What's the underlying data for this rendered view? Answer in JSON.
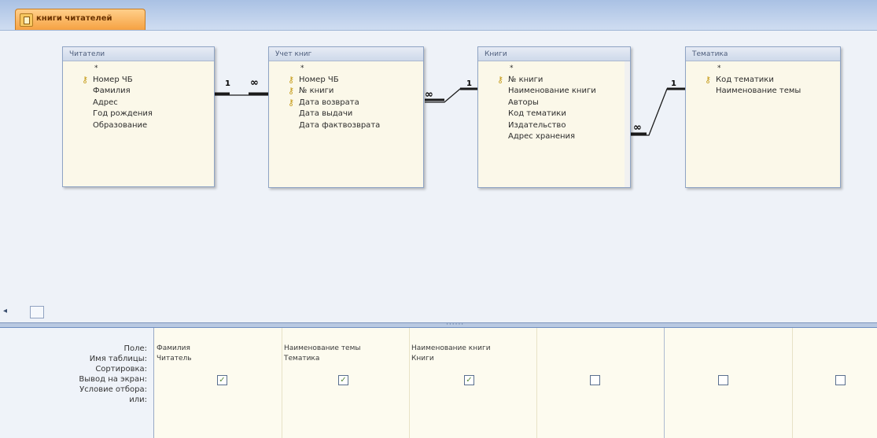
{
  "tab": {
    "title": "книги читателей",
    "icon": "query-icon"
  },
  "tables": [
    {
      "title": "Читатели",
      "fields": [
        {
          "name": "*",
          "key": false
        },
        {
          "name": "Номер ЧБ",
          "key": true
        },
        {
          "name": "Фамилия",
          "key": false
        },
        {
          "name": "Адрес",
          "key": false
        },
        {
          "name": "Год рождения",
          "key": false
        },
        {
          "name": "Образование",
          "key": false
        }
      ]
    },
    {
      "title": "Учет книг",
      "fields": [
        {
          "name": "*",
          "key": false
        },
        {
          "name": "Номер ЧБ",
          "key": true
        },
        {
          "name": "№ книги",
          "key": true
        },
        {
          "name": "Дата возврата",
          "key": true
        },
        {
          "name": "Дата выдачи",
          "key": false
        },
        {
          "name": "Дата фактвозврата",
          "key": false
        }
      ]
    },
    {
      "title": "Книги",
      "fields": [
        {
          "name": "*",
          "key": false
        },
        {
          "name": "№ книги",
          "key": true
        },
        {
          "name": "Наименование книги",
          "key": false
        },
        {
          "name": "Авторы",
          "key": false
        },
        {
          "name": "Код тематики",
          "key": false
        },
        {
          "name": "Издательство",
          "key": false
        },
        {
          "name": "Адрес хранения",
          "key": false
        }
      ]
    },
    {
      "title": "Тематика",
      "fields": [
        {
          "name": "*",
          "key": false
        },
        {
          "name": "Код тематики",
          "key": true
        },
        {
          "name": "Наименование темы",
          "key": false
        }
      ]
    }
  ],
  "relations": [
    {
      "one_label": "1",
      "many_label": "∞"
    },
    {
      "one_label": "1",
      "many_label": "∞"
    },
    {
      "one_label": "1",
      "many_label": "∞"
    }
  ],
  "grid": {
    "row_labels": {
      "field": "Поле:",
      "table": "Имя таблицы:",
      "sort": "Сортировка:",
      "show": "Вывод на экран:",
      "criteria": "Условие отбора:",
      "or": "или:"
    },
    "columns": [
      {
        "field": "Фамилия",
        "table": "Читатель",
        "show": true
      },
      {
        "field": "Наименование темы",
        "table": "Тематика",
        "show": true
      },
      {
        "field": "Наименование книги",
        "table": "Книги",
        "show": true
      },
      {
        "field": "",
        "table": "",
        "show": false
      },
      {
        "field": "",
        "table": "",
        "show": false
      },
      {
        "field": "",
        "table": "",
        "show": false
      }
    ]
  },
  "scroll": {
    "left_arrow": "◂"
  },
  "colors": {
    "tab_accent": "#f5a040",
    "field_list_bg": "#fbf8e9",
    "key_icon": "#c59a16"
  }
}
